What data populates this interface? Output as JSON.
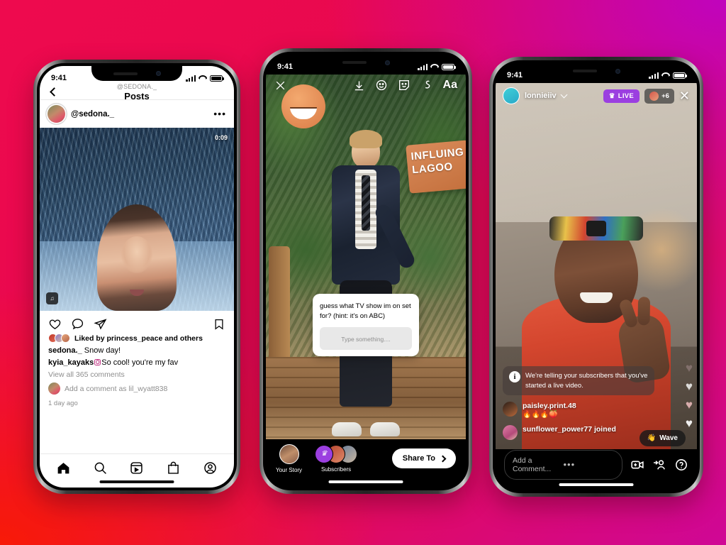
{
  "background": {
    "color_top_left": "#ee0a4e",
    "color_top_right": "#c004bd",
    "color_bottom_left": "#f81a07",
    "color_bottom_right": "#e00a63"
  },
  "phone1": {
    "status": {
      "time": "9:41"
    },
    "header": {
      "back_icon": "chevron-left-icon",
      "account": "@SEDONA._",
      "title": "Posts"
    },
    "post": {
      "username": "@sedona._",
      "more_icon": "more-options-icon",
      "duration": "0:09",
      "audio_icon": "audio-attribution-icon",
      "actions": {
        "like": "heart-icon",
        "comment": "comment-icon",
        "share": "share-icon",
        "save": "bookmark-icon"
      },
      "liked_by": "Liked by princess_peace and others",
      "caption_user": "sedona._",
      "caption_text": "Snow day!",
      "comment_user": "kyia_kayaks",
      "comment_text": "So cool! you're my fav",
      "view_all": "View all 365 comments",
      "add_comment": "Add a comment as lil_wyatt838",
      "timestamp": "1 day ago"
    },
    "nav": [
      {
        "name": "home",
        "icon": "home-icon"
      },
      {
        "name": "search",
        "icon": "search-icon"
      },
      {
        "name": "reels",
        "icon": "reels-icon"
      },
      {
        "name": "shop",
        "icon": "shop-bag-icon"
      },
      {
        "name": "profile",
        "icon": "profile-icon"
      }
    ]
  },
  "phone2": {
    "status": {
      "time": "9:41"
    },
    "toolbar": [
      {
        "name": "close",
        "icon": "close-icon"
      },
      {
        "name": "download",
        "icon": "download-icon"
      },
      {
        "name": "effects",
        "icon": "effects-face-icon"
      },
      {
        "name": "stickers",
        "icon": "sticker-icon"
      },
      {
        "name": "draw",
        "icon": "draw-squiggle-icon"
      },
      {
        "name": "text",
        "icon": "text-aa-icon",
        "label": "Aa"
      }
    ],
    "sticker": {
      "question": "guess what TV show im on set for? (hint: it's on ABC)",
      "placeholder": "Type something...."
    },
    "sign_text": "INFLUING LAGOO",
    "share_row": {
      "your_story_label": "Your Story",
      "subscribers_label": "Subscribers",
      "subscribers_icon": "crown-icon",
      "share_button": "Share To",
      "share_chevron": "chevron-right-icon"
    }
  },
  "phone3": {
    "status": {
      "time": "9:41"
    },
    "header": {
      "username": "lonnieiiv",
      "dropdown_icon": "chevron-down-icon",
      "live_label": "LIVE",
      "live_icon": "crown-icon",
      "live_color": "#9b3fe0",
      "viewer_count": "+6",
      "close_icon": "close-icon"
    },
    "chat": {
      "system_icon": "info-icon",
      "system_message": "We're telling your subscribers that you've started a live video.",
      "messages": [
        {
          "user": "paisley.print.48",
          "text": "🔥🔥🔥🍑"
        },
        {
          "user": "sunflower_power77 joined",
          "text": ""
        }
      ],
      "wave_button": "Wave",
      "wave_icon": "wave-hand-icon"
    },
    "bottom": {
      "comment_placeholder": "Add a Comment...",
      "more_icon": "more-options-icon",
      "video_icon": "add-video-icon",
      "invite_icon": "invite-person-icon",
      "help_icon": "question-help-icon"
    }
  }
}
